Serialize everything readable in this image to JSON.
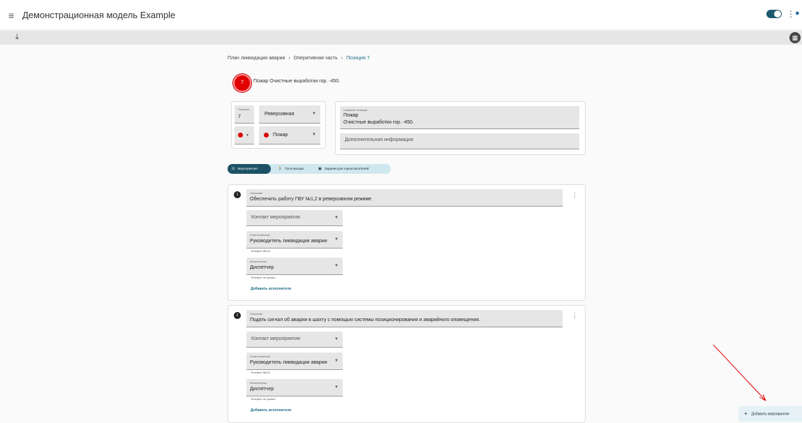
{
  "app": {
    "title": "Демонстрационная модель Example"
  },
  "breadcrumbs": [
    "План ликвидации аварии",
    "Оперативная часть",
    "Позиция 7"
  ],
  "position": {
    "number": "7",
    "title": "Пожар Очистные выработки гор. -450.",
    "number_label": "Позиция",
    "mode": "Реверсивная",
    "type": "Пожар",
    "name_label": "Название позиции",
    "name_line1": "Пожар",
    "name_line2": "Очистные выработки гор. -450.",
    "extra_placeholder": "Дополнительная информация",
    "color": "#dd0000"
  },
  "tabs": [
    {
      "label": "Мероприятия",
      "icon": "checkbox-icon",
      "active": true
    },
    {
      "label": "Пути выхода",
      "icon": "exit-person-icon",
      "active": false
    },
    {
      "label": "Задания для горноспасателей",
      "icon": "task-icon",
      "active": false
    }
  ],
  "measures": [
    {
      "number": "1",
      "desc_label": "Описание",
      "desc": "Обеспечить работу ГВУ №1,2 в реверсивном режиме",
      "contact_placeholder": "Контакт мероприятия",
      "resp_label": "Ответственный",
      "resp": "Руководитель ликвидации аварии",
      "resp_phone": "Телефон 56111",
      "exec_label": "Исполнитель",
      "exec": "Диспетчер",
      "exec_phone": "Телефон не указан",
      "add_exec": "Добавить исполнителя"
    },
    {
      "number": "2",
      "desc_label": "Описание",
      "desc": "Подать сигнал об аварии в шахту с помощью системы позиционирования и аварийного оповещения.",
      "contact_placeholder": "Контакт мероприятия",
      "resp_label": "Ответственный",
      "resp": "Руководитель ликвидации аварии",
      "resp_phone": "Телефон 56111",
      "exec_label": "Исполнитель",
      "exec": "Диспетчер",
      "exec_phone": "Телефон не указан",
      "add_exec": "Добавить исполнителя"
    }
  ],
  "fab": {
    "label": "Добавить мероприятие"
  },
  "colors": {
    "accent": "#1d5266",
    "tab_bg": "#cfe7ee",
    "fire": "#dd0000",
    "annotation": "#e00000"
  }
}
